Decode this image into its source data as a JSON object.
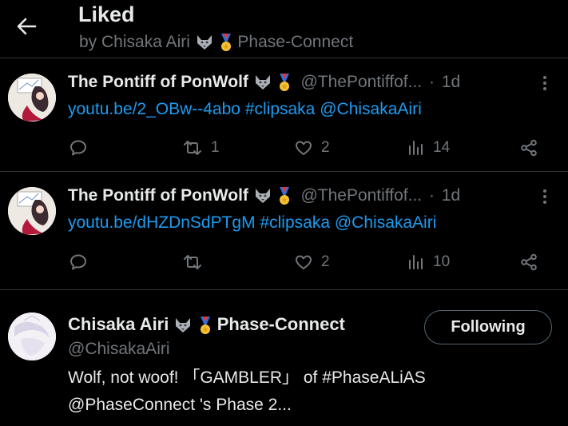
{
  "header": {
    "title": "Liked",
    "subtitle_prefix": "by Chisaka Airi",
    "subtitle_suffix": "Phase-Connect",
    "back_icon": "arrow-left-icon"
  },
  "posts": [
    {
      "name": "The Pontiff of PonWolf",
      "handle": "@ThePontiffof...",
      "dot": "·",
      "time": "1d",
      "link": "youtu.be/2_OBw--4abo",
      "hashtag": "#clipsaka",
      "mention": "@ChisakaAiri",
      "replies": "",
      "reposts": "1",
      "likes": "2",
      "views": "14"
    },
    {
      "name": "The Pontiff of PonWolf",
      "handle": "@ThePontiffof...",
      "dot": "·",
      "time": "1d",
      "link": "youtu.be/dHZDnSdPTgM",
      "hashtag": "#clipsaka",
      "mention": "@ChisakaAiri",
      "replies": "",
      "reposts": "",
      "likes": "2",
      "views": "10"
    }
  ],
  "account": {
    "name": "Chisaka Airi",
    "name_suffix": "Phase-Connect",
    "handle": "@ChisakaAiri",
    "bio_line1": "Wolf, not woof! 「GAMBLER」 of #PhaseALiAS",
    "bio_line2": "@PhaseConnect 's Phase 2...",
    "follow_label": "Following"
  },
  "colors": {
    "background": "#000000",
    "text": "#e7e9ea",
    "muted": "#71767b",
    "link": "#1d9bf0",
    "divider": "#2f3336"
  }
}
